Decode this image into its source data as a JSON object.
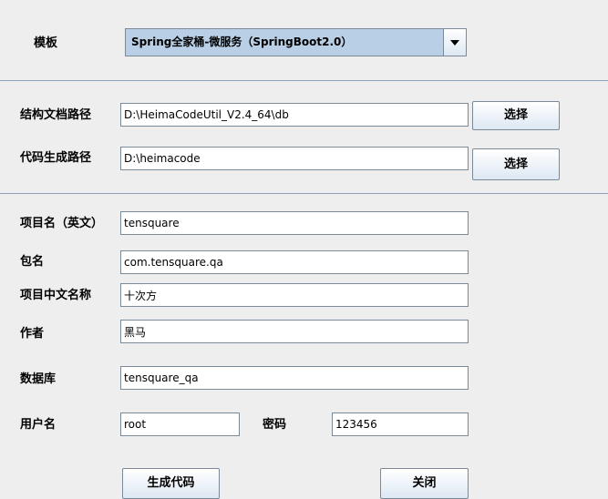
{
  "template": {
    "label": "模板",
    "selected": "Spring全家桶-微服务（SpringBoot2.0）"
  },
  "paths": {
    "structure_label": "结构文档路径",
    "structure_value": "D:\\HeimaCodeUtil_V2.4_64\\db",
    "structure_button": "选择",
    "output_label": "代码生成路径",
    "output_value": "D:\\heimacode",
    "output_button": "选择"
  },
  "project": {
    "name_en_label": "项目名（英文）",
    "name_en_value": "tensquare",
    "package_label": "包名",
    "package_value": "com.tensquare.qa",
    "name_cn_label": "项目中文名称",
    "name_cn_value": "十次方",
    "author_label": "作者",
    "author_value": "黑马",
    "database_label": "数据库",
    "database_value": "tensquare_qa",
    "username_label": "用户名",
    "username_value": "root",
    "password_label": "密码",
    "password_value": "123456"
  },
  "actions": {
    "generate": "生成代码",
    "close": "关闭"
  }
}
